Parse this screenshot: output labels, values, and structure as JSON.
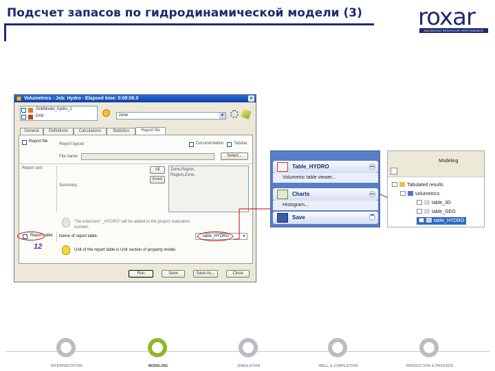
{
  "header": {
    "title": "Подсчет запасов по гидродинамической модели (3)"
  },
  "logo": {
    "text": "roxar",
    "tagline": "MAXIMIZING RESERVOIR PERFORMANCE"
  },
  "dialog": {
    "title": "Volumetrics - Job: Hydro - Elapsed time: 0:00:00.0",
    "models": [
      "GridModel_hydro_1",
      "Grid"
    ],
    "zone_value": "zone",
    "tabs": [
      "General",
      "Definitions",
      "Calculations",
      "Statistics",
      "Report file"
    ],
    "report_file_label": "Report file",
    "report_layout_label": "Report layout:",
    "documentation_label": "Documentation",
    "tabular_label": "Tabular",
    "file_name_label": "File name:",
    "select_button": "Select...",
    "report_unit_label": "Report unit",
    "all_button": "All",
    "invert_button": "Invert",
    "summary_label": "Summary:",
    "summary_items": [
      "Zone,Region,",
      "Region,Zone,"
    ],
    "extension_note": "The extension '_HYDRO' will be added to the project realization number.",
    "table_label": "Name of report table:",
    "table_value": "table_HYDRO",
    "unit_note": "Unit of the report table is Unit section of property model.",
    "checkbox_label": "Report table",
    "annotation_number": "12",
    "buttons": [
      "Run",
      "Save",
      "Save As...",
      "Close"
    ]
  },
  "side_panel": {
    "table_title": "Table_HYDRO",
    "table_sub": "Volumetric table viewer...",
    "charts_title": "Charts",
    "charts_sub": "Histogram...",
    "save_title": "Save"
  },
  "tree": {
    "header": "Modeling",
    "nodes": [
      "Tabulated results",
      "volumetrics",
      "table_3D",
      "table_GEO",
      "table_HYDRO"
    ]
  },
  "footer": {
    "stages": [
      "INTERPRETATION",
      "MODELING",
      "SIMULATION",
      "WELL & COMPLETION",
      "PRODUCTION & PROCESS"
    ],
    "active_stage": 1
  },
  "colors": {
    "brand_navy": "#1d2a6e",
    "active_stage": "#8db82a",
    "inactive_stage": "#b9bcc4",
    "annotation_red": "#cc0000"
  }
}
